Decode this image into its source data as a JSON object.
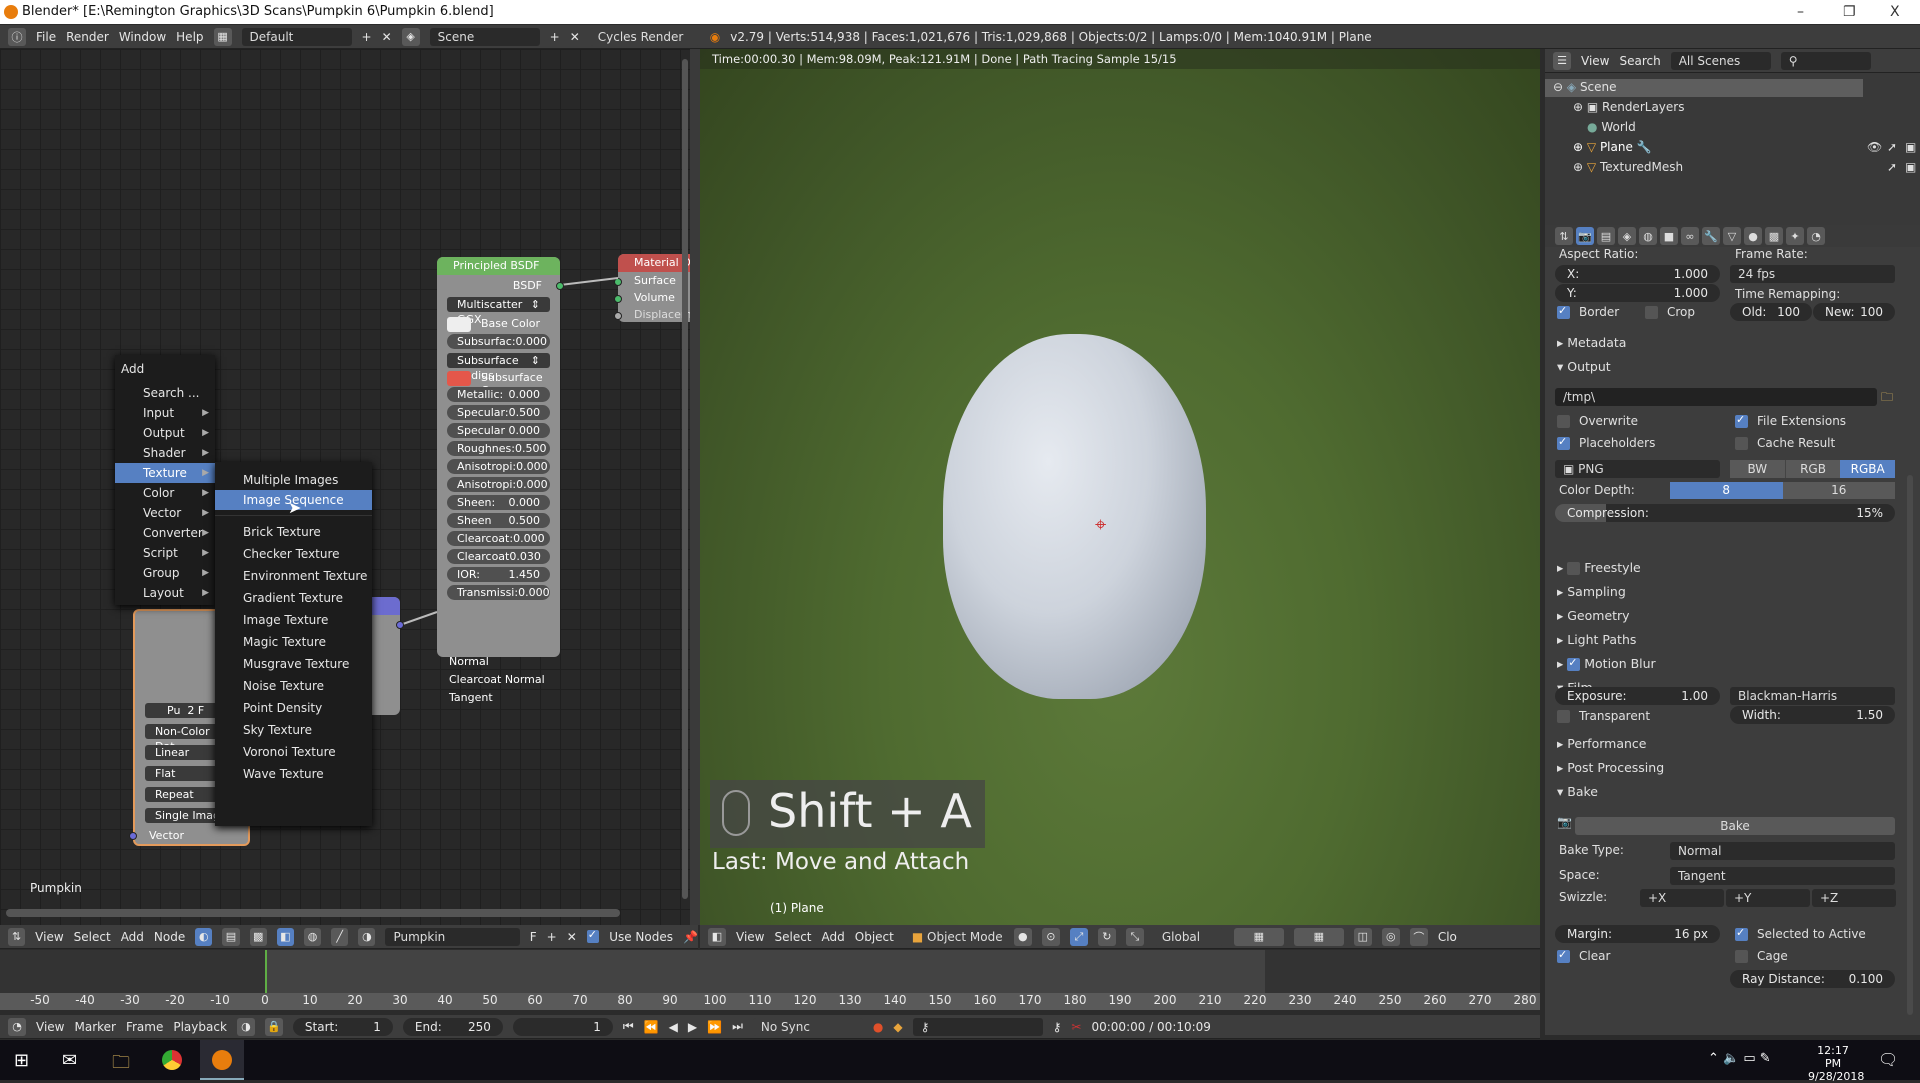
{
  "window": {
    "title": "Blender* [E:\\Remington Graphics\\3D Scans\\Pumpkin 6\\Pumpkin 6.blend]",
    "minimize": "–",
    "maximize": "❐",
    "close": "X"
  },
  "info_header": {
    "menus": [
      "File",
      "Render",
      "Window",
      "Help"
    ],
    "layout": "Default",
    "scene": "Scene",
    "engine": "Cycles Render",
    "stats": "v2.79 | Verts:514,938 | Faces:1,021,676 | Tris:1,029,868 | Objects:0/2 | Lamps:0/0 | Mem:1040.91M | Plane"
  },
  "node_editor": {
    "label": "Pumpkin",
    "principled": {
      "title": "Principled BSDF",
      "output": "BSDF",
      "distribution": "Multiscatter GGX",
      "base_color": "Base Color",
      "subsurface_radius": "Subsurface Radius",
      "subsurface_color": "Subsurface C...",
      "sliders": [
        {
          "label": "Subsurfac:",
          "value": "0.000"
        },
        {
          "label": "Metallic:",
          "value": "0.000"
        },
        {
          "label": "Specular:",
          "value": "0.500"
        },
        {
          "label": "Specular T:",
          "value": "0.000"
        },
        {
          "label": "Roughnes:",
          "value": "0.500"
        },
        {
          "label": "Anisotropi:",
          "value": "0.000"
        },
        {
          "label": "Anisotropi:",
          "value": "0.000"
        },
        {
          "label": "Sheen:",
          "value": "0.000"
        },
        {
          "label": "Sheen Tint:",
          "value": "0.500"
        },
        {
          "label": "Clearcoat:",
          "value": "0.000"
        },
        {
          "label": "Clearcoat :",
          "value": "0.030"
        },
        {
          "label": "IOR:",
          "value": "1.450"
        },
        {
          "label": "Transmissi:",
          "value": "0.000"
        }
      ],
      "inputs": [
        "Normal",
        "Clearcoat Normal",
        "Tangent"
      ]
    },
    "material_output": {
      "title": "Material O",
      "inputs": [
        "Surface",
        "Volume",
        "Displacement"
      ]
    },
    "image_node": {
      "image": "Pu",
      "users": "2",
      "fake": "F",
      "color_space": "Non-Color Dat",
      "interpolation": "Linear",
      "projection": "Flat",
      "extension": "Repeat",
      "source": "Single Image",
      "vector": "Vector"
    },
    "add_menu": {
      "title": "Add",
      "items": [
        {
          "label": "Search ...",
          "sub": false
        },
        {
          "label": "Input",
          "sub": true
        },
        {
          "label": "Output",
          "sub": true
        },
        {
          "label": "Shader",
          "sub": true
        },
        {
          "label": "Texture",
          "sub": true,
          "selected": true
        },
        {
          "label": "Color",
          "sub": true
        },
        {
          "label": "Vector",
          "sub": true
        },
        {
          "label": "Converter",
          "sub": true
        },
        {
          "label": "Script",
          "sub": true
        },
        {
          "label": "Group",
          "sub": true
        },
        {
          "label": "Layout",
          "sub": true
        }
      ]
    },
    "texture_menu": {
      "top": [
        "Multiple Images",
        "Image Sequence"
      ],
      "selected": "Image Sequence",
      "items": [
        "Brick Texture",
        "Checker Texture",
        "Environment Texture",
        "Gradient Texture",
        "Image Texture",
        "Magic Texture",
        "Musgrave Texture",
        "Noise Texture",
        "Point Density",
        "Sky Texture",
        "Voronoi Texture",
        "Wave Texture"
      ]
    },
    "header": {
      "menus": [
        "View",
        "Select",
        "Add",
        "Node"
      ],
      "material": "Pumpkin",
      "fake": "F",
      "use_nodes": "Use Nodes",
      "use_nodes_checked": true
    }
  },
  "viewport": {
    "render_status": "Time:00:00.30 | Mem:98.09M, Peak:121.91M | Done | Path Tracing Sample 15/15",
    "shortcut": "Shift + A",
    "last_op": "Last: Move and Attach",
    "object_label": "(1) Plane",
    "header": {
      "menus": [
        "View",
        "Select",
        "Add",
        "Object"
      ],
      "mode": "Object Mode",
      "orientation": "Global",
      "trailing": "Clo"
    }
  },
  "outliner": {
    "header": {
      "view": "View",
      "search": "Search",
      "filter": "All Scenes"
    },
    "items": [
      "Scene",
      "RenderLayers",
      "World",
      "Plane",
      "TexturedMesh"
    ]
  },
  "properties": {
    "aspect_label": "Aspect Ratio:",
    "aspect_x": {
      "label": "X:",
      "value": "1.000"
    },
    "aspect_y": {
      "label": "Y:",
      "value": "1.000"
    },
    "frame_rate_label": "Frame Rate:",
    "frame_rate": "24 fps",
    "time_remap_label": "Time Remapping:",
    "old": {
      "label": "Old:",
      "value": "100"
    },
    "new": {
      "label": "New:",
      "value": "100"
    },
    "border": {
      "label": "Border",
      "checked": true
    },
    "crop": {
      "label": "Crop",
      "checked": false
    },
    "metadata": "Metadata",
    "output": "Output",
    "output_path": "/tmp\\",
    "overwrite": {
      "label": "Overwrite",
      "checked": false
    },
    "file_ext": {
      "label": "File Extensions",
      "checked": true
    },
    "placeholders": {
      "label": "Placeholders",
      "checked": true
    },
    "cache": {
      "label": "Cache Result",
      "checked": false
    },
    "format": "PNG",
    "color_modes": [
      "BW",
      "RGB",
      "RGBA"
    ],
    "color_mode_selected": "RGBA",
    "color_depth_label": "Color Depth:",
    "depths": [
      "8",
      "16"
    ],
    "depth_selected": "8",
    "compression": {
      "label": "Compression:",
      "value": "15%",
      "fraction": 0.15
    },
    "sections": [
      "Freestyle",
      "Sampling",
      "Geometry",
      "Light Paths",
      "Motion Blur",
      "Film"
    ],
    "freestyle_checked": false,
    "motion_blur_checked": true,
    "exposure": {
      "label": "Exposure:",
      "value": "1.00"
    },
    "filter": "Blackman-Harris",
    "transparent": {
      "label": "Transparent",
      "checked": false
    },
    "width": {
      "label": "Width:",
      "value": "1.50"
    },
    "sections2": [
      "Performance",
      "Post Processing",
      "Bake"
    ],
    "bake_button": "Bake",
    "bake_type": {
      "label": "Bake Type:",
      "value": "Normal"
    },
    "space": {
      "label": "Space:",
      "value": "Tangent"
    },
    "swizzle": {
      "label": "Swizzle:",
      "values": [
        "+X",
        "+Y",
        "+Z"
      ]
    },
    "margin": {
      "label": "Margin:",
      "value": "16 px"
    },
    "selected_to_active": {
      "label": "Selected to Active",
      "checked": true
    },
    "clear": {
      "label": "Clear",
      "checked": true
    },
    "cage": {
      "label": "Cage",
      "checked": false
    },
    "ray_distance": {
      "label": "Ray Distance:",
      "value": "0.100"
    }
  },
  "timeline": {
    "ticks": [
      "-50",
      "-40",
      "-30",
      "-20",
      "-10",
      "0",
      "10",
      "20",
      "30",
      "40",
      "50",
      "60",
      "70",
      "80",
      "90",
      "100",
      "110",
      "120",
      "130",
      "140",
      "150",
      "160",
      "170",
      "180",
      "190",
      "200",
      "210",
      "220",
      "230",
      "240",
      "250",
      "260",
      "270",
      "280"
    ],
    "current_frame": 1,
    "header": {
      "menus": [
        "View",
        "Marker",
        "Frame",
        "Playback"
      ],
      "start": {
        "label": "Start:",
        "value": "1"
      },
      "end": {
        "label": "End:",
        "value": "250"
      },
      "frame": "1",
      "sync": "No Sync",
      "time": "00:00:00 / 00:10:09"
    }
  },
  "taskbar": {
    "time": "12:17 PM",
    "date": "9/28/2018",
    "apps": [
      "start",
      "mail",
      "file-explorer",
      "chrome",
      "blender"
    ]
  }
}
